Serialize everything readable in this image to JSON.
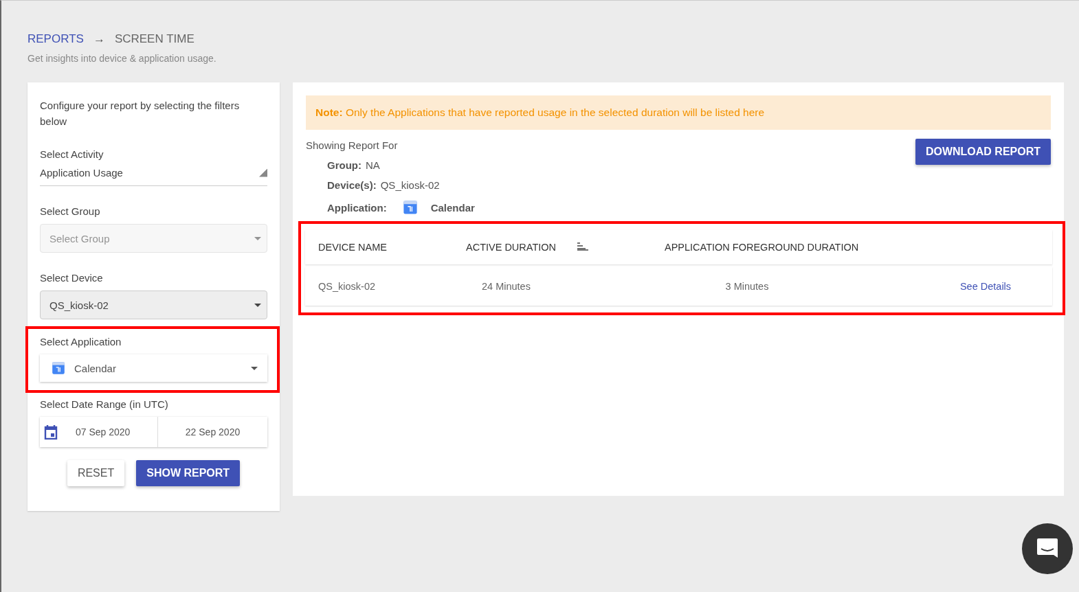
{
  "breadcrumb": {
    "parent": "REPORTS",
    "separator": "→",
    "current": "SCREEN TIME"
  },
  "subtitle": "Get insights into device & application usage.",
  "filters": {
    "intro": "Configure your report by selecting the filters below",
    "fields": [
      {
        "kind": "underline",
        "label": "Select Activity",
        "value": "Application Usage"
      },
      {
        "kind": "select",
        "label": "Select Group",
        "placeholder": "Select Group",
        "disabled": true
      },
      {
        "kind": "select",
        "label": "Select Device",
        "value": "QS_kiosk-02",
        "disabled": false
      },
      {
        "kind": "app",
        "label": "Select Application",
        "value": "Calendar",
        "highlighted": true
      },
      {
        "kind": "daterange",
        "label": "Select Date Range (in UTC)",
        "from": "07 Sep 2020",
        "to": "22 Sep 2020"
      }
    ],
    "buttons": [
      {
        "label": "RESET",
        "primary": false
      },
      {
        "label": "SHOW REPORT",
        "primary": true
      }
    ]
  },
  "report": {
    "note_label": "Note:",
    "note": "Only the Applications that have reported usage in the selected duration will be listed here",
    "heading": "Showing Report For",
    "download": "DOWNLOAD REPORT",
    "details": [
      {
        "kind": "text",
        "label": "Group:",
        "value": "NA"
      },
      {
        "kind": "text",
        "label": "Device(s):",
        "value": "QS_kiosk-02"
      },
      {
        "kind": "app",
        "label": "Application:",
        "value": "Calendar"
      }
    ],
    "table": {
      "highlighted": true,
      "columns": [
        "DEVICE NAME",
        "ACTIVE DURATION",
        "APPLICATION FOREGROUND DURATION"
      ],
      "rows": [
        {
          "device": "QS_kiosk-02",
          "active": "24 Minutes",
          "foreground": "3 Minutes",
          "link": "See Details"
        }
      ]
    }
  }
}
